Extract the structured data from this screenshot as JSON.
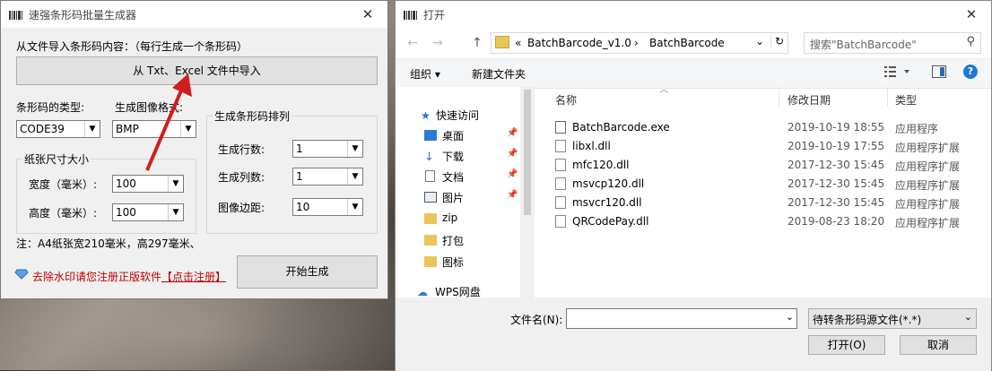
{
  "win1": {
    "title": "速强条形码批量生成器",
    "close": "✕",
    "import_label": "从文件导入条形码内容：（每行生成一个条形码）",
    "import_button": "从 Txt、Excel 文件中导入",
    "barcode_type_label": "条形码的类型:",
    "barcode_type_value": "CODE39",
    "image_format_label": "生成图像格式:",
    "image_format_value": "BMP",
    "paper_group": "纸张尺寸大小",
    "width_label": "宽度（毫米）:",
    "width_value": "100",
    "height_label": "高度（毫米）:",
    "height_value": "100",
    "layout_group": "生成条形码排列",
    "rows_label": "生成行数:",
    "rows_value": "1",
    "cols_label": "生成列数:",
    "cols_value": "1",
    "margin_label": "图像边距:",
    "margin_value": "10",
    "note": "注：A4纸张宽210毫米，高297毫米、",
    "watermark_text": "去除水印请您注册正版软件",
    "register_link": "【点击注册】",
    "start_button": "开始生成"
  },
  "win2": {
    "title": "打开",
    "close": "✕",
    "nav_back": "←",
    "nav_forward": "→",
    "nav_up": "↑",
    "address": {
      "prefix": "«",
      "crumb1": "BatchBarcode_v1.0",
      "sep": "›",
      "crumb2": "BatchBarcode",
      "dropdown": "⌄",
      "refresh": "↻"
    },
    "search_placeholder": "搜索\"BatchBarcode\"",
    "toolbar": {
      "organize": "组织 ▾",
      "new_folder": "新建文件夹",
      "help": "?"
    },
    "nav": {
      "quick_access": "快速访问",
      "items": [
        "桌面",
        "下载",
        "文档",
        "图片",
        "zip",
        "打包",
        "图标"
      ],
      "wps": "WPS网盘"
    },
    "columns": {
      "name": "名称",
      "modified": "修改日期",
      "type": "类型"
    },
    "files": [
      {
        "name": "BatchBarcode.exe",
        "date": "2019-10-19 18:55",
        "type": "应用程序"
      },
      {
        "name": "libxl.dll",
        "date": "2019-10-19 17:55",
        "type": "应用程序扩展"
      },
      {
        "name": "mfc120.dll",
        "date": "2017-12-30 15:45",
        "type": "应用程序扩展"
      },
      {
        "name": "msvcp120.dll",
        "date": "2017-12-30 15:45",
        "type": "应用程序扩展"
      },
      {
        "name": "msvcr120.dll",
        "date": "2017-12-30 15:45",
        "type": "应用程序扩展"
      },
      {
        "name": "QRCodePay.dll",
        "date": "2019-08-23 18:20",
        "type": "应用程序扩展"
      }
    ],
    "filename_label": "文件名(N):",
    "filename_value": "",
    "filter_value": "待转条形码源文件(*.*)",
    "open_button": "打开(O)",
    "cancel_button": "取消"
  },
  "colors": {
    "arrow": "#d11d1d",
    "link_red": "#c00000",
    "accent_blue": "#0078d7"
  }
}
